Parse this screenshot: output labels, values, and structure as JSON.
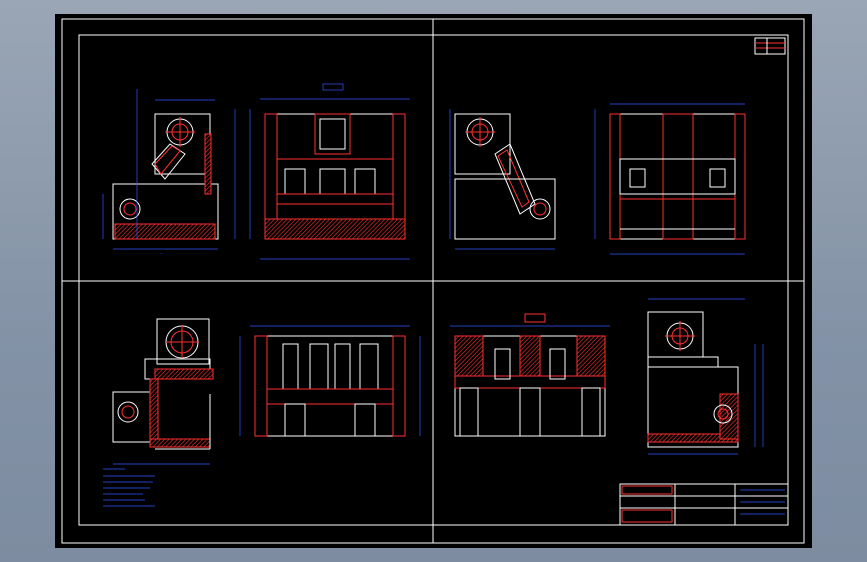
{
  "canvas": {
    "background": "#000000",
    "frame_color": "#ffffff",
    "line_color": "#ff3030",
    "dimension_color": "#3355ff"
  },
  "views": [
    "top-left-assembly",
    "top-right-assembly",
    "bottom-left-assembly",
    "bottom-right-assembly"
  ]
}
